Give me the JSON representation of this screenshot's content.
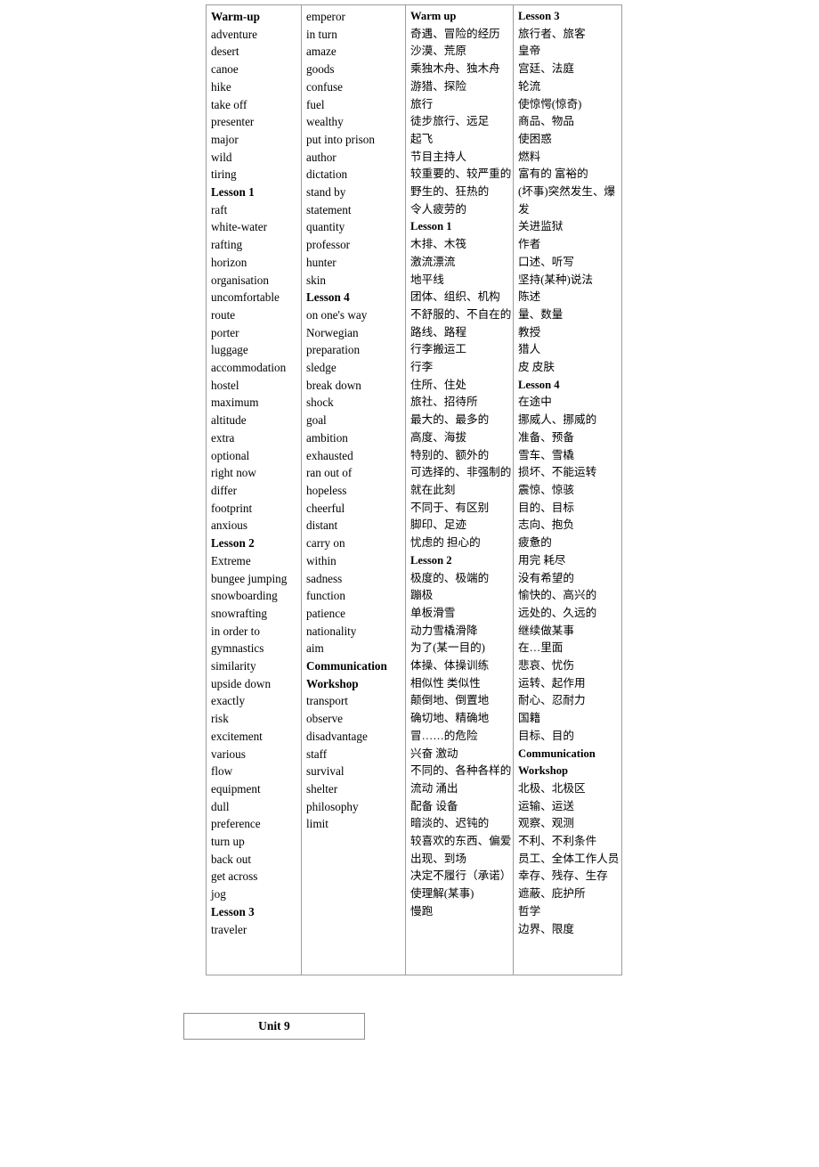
{
  "document": {
    "unit_box": {
      "label": "Unit 9"
    }
  },
  "table": {
    "columns": [
      {
        "name": "english-column-1",
        "lang": "en",
        "entries": [
          {
            "text": "Warm-up",
            "heading": true
          },
          {
            "text": "adventure",
            "heading": false
          },
          {
            "text": "desert",
            "heading": false
          },
          {
            "text": "canoe",
            "heading": false
          },
          {
            "text": "hike",
            "heading": false
          },
          {
            "text": "take off",
            "heading": false
          },
          {
            "text": "presenter",
            "heading": false
          },
          {
            "text": "major",
            "heading": false
          },
          {
            "text": "wild",
            "heading": false
          },
          {
            "text": "tiring",
            "heading": false
          },
          {
            "text": "Lesson 1",
            "heading": true
          },
          {
            "text": "raft",
            "heading": false
          },
          {
            "text": "white-water",
            "heading": false
          },
          {
            "text": "rafting",
            "heading": false
          },
          {
            "text": "horizon",
            "heading": false
          },
          {
            "text": "organisation",
            "heading": false
          },
          {
            "text": "uncomfortable",
            "heading": false
          },
          {
            "text": "route",
            "heading": false
          },
          {
            "text": "porter",
            "heading": false
          },
          {
            "text": "luggage",
            "heading": false
          },
          {
            "text": "accommodation",
            "heading": false
          },
          {
            "text": "hostel",
            "heading": false
          },
          {
            "text": "maximum",
            "heading": false
          },
          {
            "text": "altitude",
            "heading": false
          },
          {
            "text": "extra",
            "heading": false
          },
          {
            "text": "optional",
            "heading": false
          },
          {
            "text": "right now",
            "heading": false
          },
          {
            "text": "differ",
            "heading": false
          },
          {
            "text": "footprint",
            "heading": false
          },
          {
            "text": "anxious",
            "heading": false
          },
          {
            "text": "Lesson 2",
            "heading": true
          },
          {
            "text": "Extreme",
            "heading": false
          },
          {
            "text": "bungee jumping",
            "heading": false
          },
          {
            "text": "snowboarding",
            "heading": false
          },
          {
            "text": "snowrafting",
            "heading": false
          },
          {
            "text": "in order to",
            "heading": false
          },
          {
            "text": "gymnastics",
            "heading": false
          },
          {
            "text": "similarity",
            "heading": false
          },
          {
            "text": "upside down",
            "heading": false
          },
          {
            "text": "exactly",
            "heading": false
          },
          {
            "text": "risk",
            "heading": false
          },
          {
            "text": "excitement",
            "heading": false
          },
          {
            "text": "various",
            "heading": false
          },
          {
            "text": "flow",
            "heading": false
          },
          {
            "text": "equipment",
            "heading": false
          },
          {
            "text": "dull",
            "heading": false
          },
          {
            "text": "preference",
            "heading": false
          },
          {
            "text": "turn up",
            "heading": false
          },
          {
            "text": "back out",
            "heading": false
          },
          {
            "text": "get across",
            "heading": false
          },
          {
            "text": "jog",
            "heading": false
          },
          {
            "text": "Lesson 3",
            "heading": true
          },
          {
            "text": "traveler",
            "heading": false
          }
        ]
      },
      {
        "name": "english-column-2",
        "lang": "en",
        "entries": [
          {
            "text": "emperor",
            "heading": false
          },
          {
            "text": "in turn",
            "heading": false
          },
          {
            "text": "amaze",
            "heading": false
          },
          {
            "text": "goods",
            "heading": false
          },
          {
            "text": "confuse",
            "heading": false
          },
          {
            "text": "fuel",
            "heading": false
          },
          {
            "text": "wealthy",
            "heading": false
          },
          {
            "text": "put into prison",
            "heading": false
          },
          {
            "text": "author",
            "heading": false
          },
          {
            "text": "dictation",
            "heading": false
          },
          {
            "text": "stand by",
            "heading": false
          },
          {
            "text": "statement",
            "heading": false
          },
          {
            "text": "quantity",
            "heading": false
          },
          {
            "text": "professor",
            "heading": false
          },
          {
            "text": "hunter",
            "heading": false
          },
          {
            "text": "skin",
            "heading": false
          },
          {
            "text": "Lesson 4",
            "heading": true
          },
          {
            "text": "on one's way",
            "heading": false
          },
          {
            "text": "Norwegian",
            "heading": false
          },
          {
            "text": "preparation",
            "heading": false
          },
          {
            "text": "sledge",
            "heading": false
          },
          {
            "text": "break down",
            "heading": false
          },
          {
            "text": "shock",
            "heading": false
          },
          {
            "text": "goal",
            "heading": false
          },
          {
            "text": "ambition",
            "heading": false
          },
          {
            "text": "exhausted",
            "heading": false
          },
          {
            "text": "ran out of",
            "heading": false
          },
          {
            "text": "hopeless",
            "heading": false
          },
          {
            "text": "cheerful",
            "heading": false
          },
          {
            "text": "distant",
            "heading": false
          },
          {
            "text": "carry on",
            "heading": false
          },
          {
            "text": "within",
            "heading": false
          },
          {
            "text": "sadness",
            "heading": false
          },
          {
            "text": "function",
            "heading": false
          },
          {
            "text": "patience",
            "heading": false
          },
          {
            "text": "nationality",
            "heading": false
          },
          {
            "text": "aim",
            "heading": false
          },
          {
            "text": "Communication",
            "heading": true
          },
          {
            "text": "Workshop",
            "heading": true
          },
          {
            "text": "transport",
            "heading": false
          },
          {
            "text": "observe",
            "heading": false
          },
          {
            "text": "disadvantage",
            "heading": false
          },
          {
            "text": "staff",
            "heading": false
          },
          {
            "text": "survival",
            "heading": false
          },
          {
            "text": "shelter",
            "heading": false
          },
          {
            "text": "philosophy",
            "heading": false
          },
          {
            "text": "limit",
            "heading": false
          }
        ]
      },
      {
        "name": "chinese-column-1",
        "lang": "cn",
        "entries": [
          {
            "text": "Warm up",
            "heading": true
          },
          {
            "text": "奇遇、冒险的经历",
            "heading": false
          },
          {
            "text": "沙漠、荒原",
            "heading": false
          },
          {
            "text": "乘独木舟、独木舟",
            "heading": false
          },
          {
            "text": "游猎、探险",
            "heading": false
          },
          {
            "text": "旅行",
            "heading": false
          },
          {
            "text": "徒步旅行、远足",
            "heading": false
          },
          {
            "text": "起飞",
            "heading": false
          },
          {
            "text": "节目主持人",
            "heading": false
          },
          {
            "text": "较重要的、较严重的",
            "heading": false
          },
          {
            "text": "野生的、狂热的",
            "heading": false
          },
          {
            "text": "令人疲劳的",
            "heading": false
          },
          {
            "text": "Lesson 1",
            "heading": true
          },
          {
            "text": "木排、木筏",
            "heading": false
          },
          {
            "text": "激流漂流",
            "heading": false
          },
          {
            "text": "地平线",
            "heading": false
          },
          {
            "text": "团体、组织、机构",
            "heading": false
          },
          {
            "text": "不舒服的、不自在的",
            "heading": false
          },
          {
            "text": "路线、路程",
            "heading": false
          },
          {
            "text": "行李搬运工",
            "heading": false
          },
          {
            "text": "行李",
            "heading": false
          },
          {
            "text": "住所、住处",
            "heading": false
          },
          {
            "text": "旅社、招待所",
            "heading": false
          },
          {
            "text": "最大的、最多的",
            "heading": false
          },
          {
            "text": "高度、海拔",
            "heading": false
          },
          {
            "text": "特别的、额外的",
            "heading": false
          },
          {
            "text": "可选择的、非强制的",
            "heading": false
          },
          {
            "text": "就在此刻",
            "heading": false
          },
          {
            "text": "不同于、有区别",
            "heading": false
          },
          {
            "text": "脚印、足迹",
            "heading": false
          },
          {
            "text": "忧虑的 担心的",
            "heading": false
          },
          {
            "text": "Lesson 2",
            "heading": true
          },
          {
            "text": "极度的、极端的",
            "heading": false
          },
          {
            "text": "蹦极",
            "heading": false
          },
          {
            "text": "单板滑雪",
            "heading": false
          },
          {
            "text": "动力雪橇滑降",
            "heading": false
          },
          {
            "text": "为了(某一目的)",
            "heading": false
          },
          {
            "text": "体操、体操训练",
            "heading": false
          },
          {
            "text": "相似性 类似性",
            "heading": false
          },
          {
            "text": "颠倒地、倒置地",
            "heading": false
          },
          {
            "text": "确切地、精确地",
            "heading": false
          },
          {
            "text": "冒……的危险",
            "heading": false
          },
          {
            "text": "兴奋 激动",
            "heading": false
          },
          {
            "text": "不同的、各种各样的",
            "heading": false
          },
          {
            "text": "流动 涌出",
            "heading": false
          },
          {
            "text": "配备 设备",
            "heading": false
          },
          {
            "text": "暗淡的、迟钝的",
            "heading": false
          },
          {
            "text": "较喜欢的东西、偏爱",
            "heading": false
          },
          {
            "text": "出现、到场",
            "heading": false
          },
          {
            "text": "决定不履行（承诺）",
            "heading": false
          },
          {
            "text": "使理解(某事)",
            "heading": false
          },
          {
            "text": "慢跑",
            "heading": false
          }
        ]
      },
      {
        "name": "chinese-column-2",
        "lang": "cn",
        "entries": [
          {
            "text": "Lesson 3",
            "heading": true
          },
          {
            "text": "旅行者、旅客",
            "heading": false
          },
          {
            "text": "皇帝",
            "heading": false
          },
          {
            "text": "宫廷、法庭",
            "heading": false
          },
          {
            "text": "轮流",
            "heading": false
          },
          {
            "text": "使惊愕(惊奇)",
            "heading": false
          },
          {
            "text": "商品、物品",
            "heading": false
          },
          {
            "text": "使困惑",
            "heading": false
          },
          {
            "text": "燃料",
            "heading": false
          },
          {
            "text": "富有的 富裕的",
            "heading": false
          },
          {
            "text": "(坏事)突然发生、爆发",
            "heading": false
          },
          {
            "text": "关进监狱",
            "heading": false
          },
          {
            "text": "作者",
            "heading": false
          },
          {
            "text": "口述、听写",
            "heading": false
          },
          {
            "text": "坚持(某种)说法",
            "heading": false
          },
          {
            "text": "陈述",
            "heading": false
          },
          {
            "text": "量、数量",
            "heading": false
          },
          {
            "text": "教授",
            "heading": false
          },
          {
            "text": "猎人",
            "heading": false
          },
          {
            "text": "皮 皮肤",
            "heading": false
          },
          {
            "text": "Lesson 4",
            "heading": true
          },
          {
            "text": "在途中",
            "heading": false
          },
          {
            "text": "挪威人、挪威的",
            "heading": false
          },
          {
            "text": "准备、预备",
            "heading": false
          },
          {
            "text": "雪车、雪橇",
            "heading": false
          },
          {
            "text": "损坏、不能运转",
            "heading": false
          },
          {
            "text": "震惊、惊骇",
            "heading": false
          },
          {
            "text": "目的、目标",
            "heading": false
          },
          {
            "text": "志向、抱负",
            "heading": false
          },
          {
            "text": "疲惫的",
            "heading": false
          },
          {
            "text": "用完 耗尽",
            "heading": false
          },
          {
            "text": "没有希望的",
            "heading": false
          },
          {
            "text": "愉快的、高兴的",
            "heading": false
          },
          {
            "text": "远处的、久远的",
            "heading": false
          },
          {
            "text": "继续做某事",
            "heading": false
          },
          {
            "text": "在…里面",
            "heading": false
          },
          {
            "text": "悲哀、忧伤",
            "heading": false
          },
          {
            "text": "运转、起作用",
            "heading": false
          },
          {
            "text": "耐心、忍耐力",
            "heading": false
          },
          {
            "text": "国籍",
            "heading": false
          },
          {
            "text": "目标、目的",
            "heading": false
          },
          {
            "text": "Communication",
            "heading": true
          },
          {
            "text": "Workshop",
            "heading": true
          },
          {
            "text": "北极、北极区",
            "heading": false
          },
          {
            "text": "运输、运送",
            "heading": false
          },
          {
            "text": "观察、观测",
            "heading": false
          },
          {
            "text": "不利、不利条件",
            "heading": false
          },
          {
            "text": "员工、全体工作人员",
            "heading": false
          },
          {
            "text": "幸存、残存、生存",
            "heading": false
          },
          {
            "text": "遮蔽、庇护所",
            "heading": false
          },
          {
            "text": "哲学",
            "heading": false
          },
          {
            "text": "边界、限度",
            "heading": false
          }
        ]
      }
    ]
  }
}
